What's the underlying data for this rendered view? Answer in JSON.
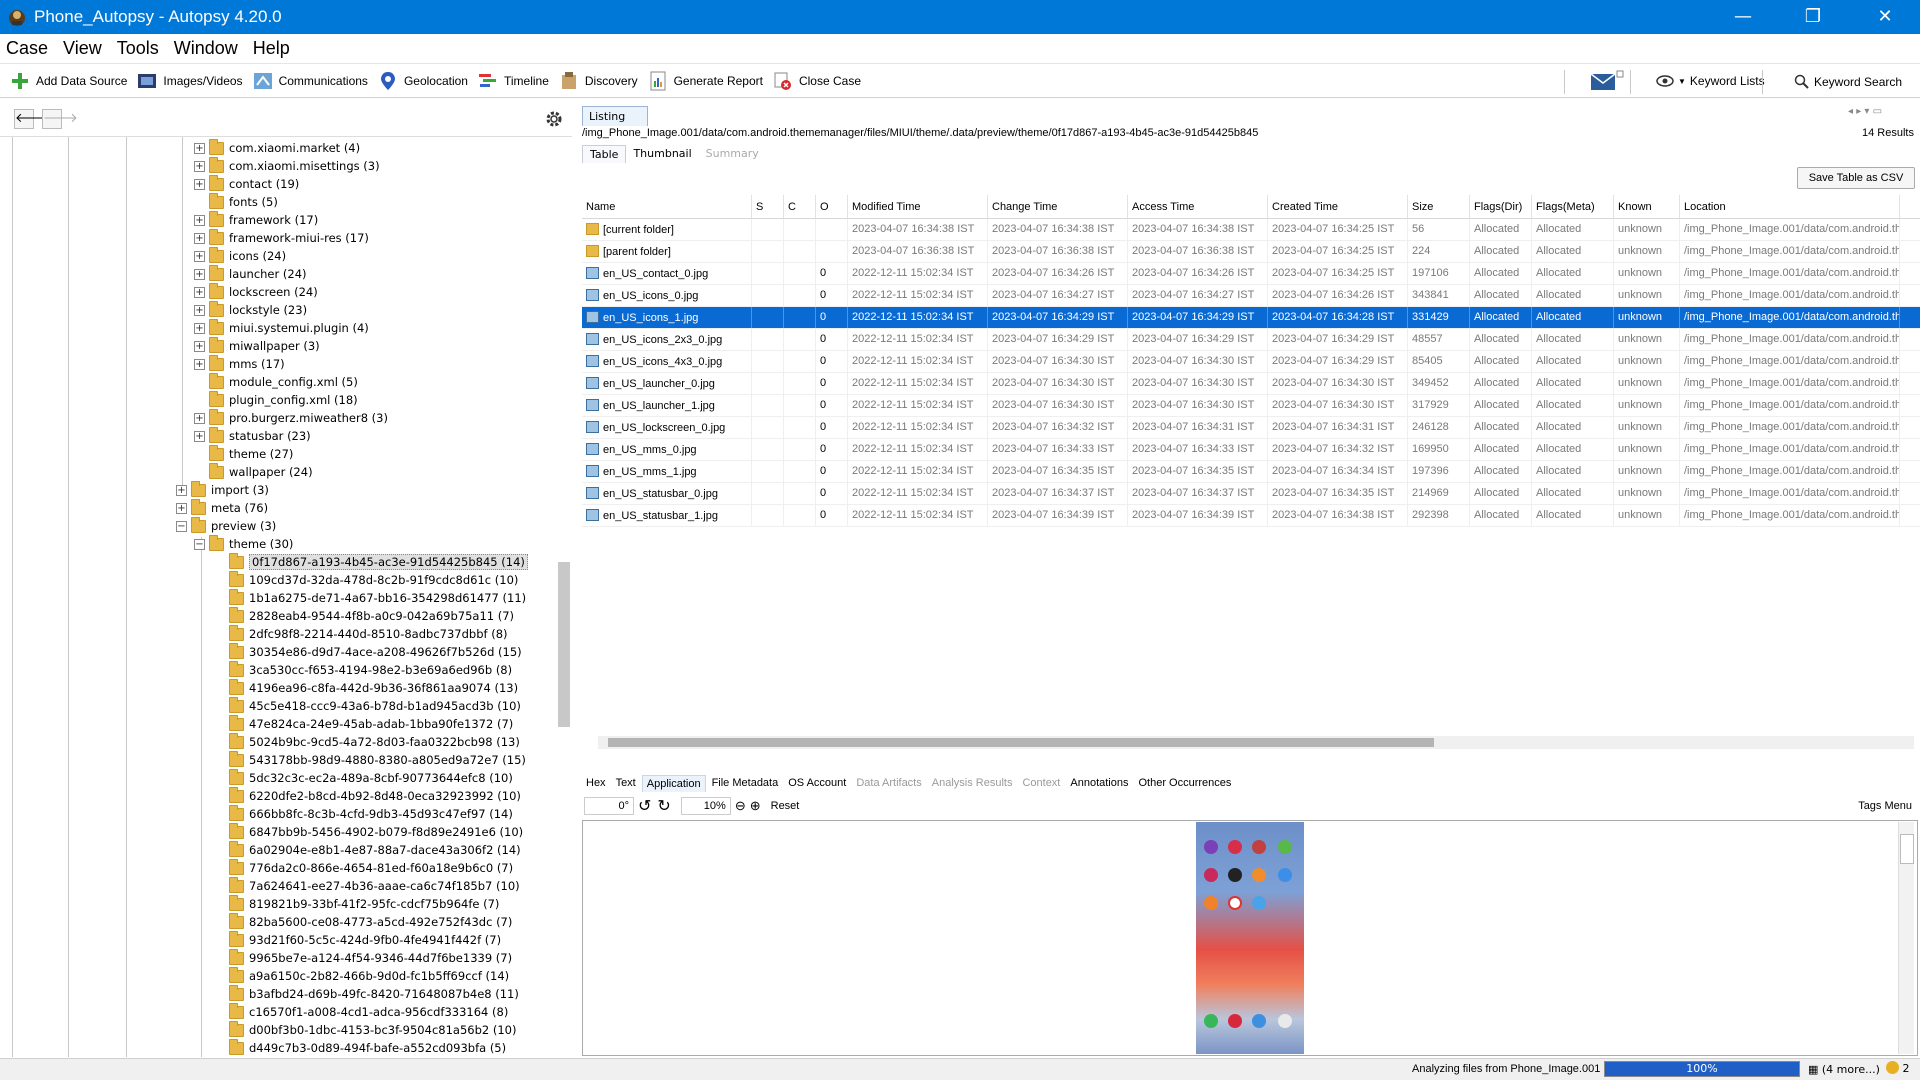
{
  "window": {
    "title": "Phone_Autopsy - Autopsy 4.20.0",
    "minimize": "—",
    "maximize": "❐",
    "close": "✕"
  },
  "menu": [
    "Case",
    "View",
    "Tools",
    "Window",
    "Help"
  ],
  "toolbar": {
    "add_data_source": "Add Data Source",
    "images_videos": "Images/Videos",
    "communications": "Communications",
    "geolocation": "Geolocation",
    "timeline": "Timeline",
    "discovery": "Discovery",
    "generate_report": "Generate Report",
    "close_case": "Close Case",
    "keyword_lists": "Keyword Lists",
    "keyword_search": "Keyword Search"
  },
  "tree": {
    "items": [
      {
        "label": "com.xiaomi.market (4)",
        "exp": true
      },
      {
        "label": "com.xiaomi.misettings (3)",
        "exp": true
      },
      {
        "label": "contact (19)",
        "exp": true
      },
      {
        "label": "fonts (5)",
        "exp": false
      },
      {
        "label": "framework (17)",
        "exp": true
      },
      {
        "label": "framework-miui-res (17)",
        "exp": true
      },
      {
        "label": "icons (24)",
        "exp": true
      },
      {
        "label": "launcher (24)",
        "exp": true
      },
      {
        "label": "lockscreen (24)",
        "exp": true
      },
      {
        "label": "lockstyle (23)",
        "exp": true
      },
      {
        "label": "miui.systemui.plugin (4)",
        "exp": true
      },
      {
        "label": "miwallpaper (3)",
        "exp": true
      },
      {
        "label": "mms (17)",
        "exp": true
      },
      {
        "label": "module_config.xml (5)",
        "exp": false
      },
      {
        "label": "plugin_config.xml (18)",
        "exp": false
      },
      {
        "label": "pro.burgerz.miweather8 (3)",
        "exp": true
      },
      {
        "label": "statusbar (23)",
        "exp": true
      },
      {
        "label": "theme (27)",
        "exp": false
      },
      {
        "label": "wallpaper (24)",
        "exp": false
      }
    ],
    "level1": [
      {
        "label": "import (3)",
        "sign": "+"
      },
      {
        "label": "meta (76)",
        "sign": "+"
      },
      {
        "label": "preview (3)",
        "sign": "−"
      }
    ],
    "theme_node": "theme (30)",
    "theme_children": [
      "0f17d867-a193-4b45-ac3e-91d54425b845 (14)",
      "109cd37d-32da-478d-8c2b-91f9cdc8d61c (10)",
      "1b1a6275-de71-4a67-bb16-354298d61477 (11)",
      "2828eab4-9544-4f8b-a0c9-042a69b75a11 (7)",
      "2dfc98f8-2214-440d-8510-8adbc737dbbf (8)",
      "30354e86-d9d7-4ace-a208-49626f7b526d (15)",
      "3ca530cc-f653-4194-98e2-b3e69a6ed96b (8)",
      "4196ea96-c8fa-442d-9b36-36f861aa9074 (13)",
      "45c5e418-ccc9-43a6-b78d-b1ad945acd3b (10)",
      "47e824ca-24e9-45ab-adab-1bba90fe1372 (7)",
      "5024b9bc-9cd5-4a72-8d03-faa0322bcb98 (13)",
      "543178bb-98d9-4880-8380-a805ed9a72e7 (15)",
      "5dc32c3c-ec2a-489a-8cbf-90773644efc8 (10)",
      "6220dfe2-b8cd-4b92-8d48-0eca32923992 (10)",
      "666bb8fc-8c3b-4cfd-9db3-45d93c47ef97 (14)",
      "6847bb9b-5456-4902-b079-f8d89e2491e6 (10)",
      "6a02904e-e8b1-4e87-88a7-dace43a306f2 (14)",
      "776da2c0-866e-4654-81ed-f60a18e9b6c0 (7)",
      "7a624641-ee27-4b36-aaae-ca6c74f185b7 (10)",
      "819821b9-33bf-41f2-95fc-cdcf75b964fe (7)",
      "82ba5600-ce08-4773-a5cd-492e752f43dc (7)",
      "93d21f60-5c5c-424d-9fb0-4fe4941f442f (7)",
      "9965be7e-a124-4f54-9346-44d7f6be1339 (7)",
      "a9a6150c-2b82-466b-9d0d-fc1b5ff69ccf (14)",
      "b3afbd24-d69b-49fc-8420-71648087b4e8 (11)",
      "c16570f1-a008-4cd1-adca-956cdf333164 (8)",
      "d00bf3b0-1dbc-4153-bc3f-9504c81a56b2 (10)",
      "d449c7b3-0d89-494f-bafe-a552cd093bfa (5)"
    ]
  },
  "listing": {
    "tab": "Listing",
    "path": "/img_Phone_Image.001/data/com.android.thememanager/files/MIUI/theme/.data/preview/theme/0f17d867-a193-4b45-ac3e-91d54425b845",
    "results": "14  Results",
    "subtabs": [
      "Table",
      "Thumbnail",
      "Summary"
    ],
    "save_csv": "Save Table as CSV",
    "columns": [
      "Name",
      "S",
      "C",
      "O",
      "Modified Time",
      "Change Time",
      "Access Time",
      "Created Time",
      "Size",
      "Flags(Dir)",
      "Flags(Meta)",
      "Known",
      "Location"
    ],
    "rows": [
      {
        "icon": "folder",
        "name": "[current folder]",
        "o": "",
        "mod": "2023-04-07 16:34:38 IST",
        "chg": "2023-04-07 16:34:38 IST",
        "acc": "2023-04-07 16:34:38 IST",
        "cre": "2023-04-07 16:34:25 IST",
        "size": "56",
        "fdir": "Allocated",
        "fmeta": "Allocated",
        "known": "unknown",
        "loc": "/img_Phone_Image.001/data/com.android.the"
      },
      {
        "icon": "folder",
        "name": "[parent folder]",
        "o": "",
        "mod": "2023-04-07 16:36:38 IST",
        "chg": "2023-04-07 16:36:38 IST",
        "acc": "2023-04-07 16:36:38 IST",
        "cre": "2023-04-07 16:34:25 IST",
        "size": "224",
        "fdir": "Allocated",
        "fmeta": "Allocated",
        "known": "unknown",
        "loc": "/img_Phone_Image.001/data/com.android.the"
      },
      {
        "icon": "image",
        "name": "en_US_contact_0.jpg",
        "o": "0",
        "mod": "2022-12-11 15:02:34 IST",
        "chg": "2023-04-07 16:34:26 IST",
        "acc": "2023-04-07 16:34:26 IST",
        "cre": "2023-04-07 16:34:25 IST",
        "size": "197106",
        "fdir": "Allocated",
        "fmeta": "Allocated",
        "known": "unknown",
        "loc": "/img_Phone_Image.001/data/com.android.the"
      },
      {
        "icon": "image",
        "name": "en_US_icons_0.jpg",
        "o": "0",
        "mod": "2022-12-11 15:02:34 IST",
        "chg": "2023-04-07 16:34:27 IST",
        "acc": "2023-04-07 16:34:27 IST",
        "cre": "2023-04-07 16:34:26 IST",
        "size": "343841",
        "fdir": "Allocated",
        "fmeta": "Allocated",
        "known": "unknown",
        "loc": "/img_Phone_Image.001/data/com.android.the"
      },
      {
        "icon": "image",
        "name": "en_US_icons_1.jpg",
        "o": "0",
        "mod": "2022-12-11 15:02:34 IST",
        "chg": "2023-04-07 16:34:29 IST",
        "acc": "2023-04-07 16:34:29 IST",
        "cre": "2023-04-07 16:34:28 IST",
        "size": "331429",
        "fdir": "Allocated",
        "fmeta": "Allocated",
        "known": "unknown",
        "loc": "/img_Phone_Image.001/data/com.android.the",
        "selected": true
      },
      {
        "icon": "image",
        "name": "en_US_icons_2x3_0.jpg",
        "o": "0",
        "mod": "2022-12-11 15:02:34 IST",
        "chg": "2023-04-07 16:34:29 IST",
        "acc": "2023-04-07 16:34:29 IST",
        "cre": "2023-04-07 16:34:29 IST",
        "size": "48557",
        "fdir": "Allocated",
        "fmeta": "Allocated",
        "known": "unknown",
        "loc": "/img_Phone_Image.001/data/com.android.the"
      },
      {
        "icon": "image",
        "name": "en_US_icons_4x3_0.jpg",
        "o": "0",
        "mod": "2022-12-11 15:02:34 IST",
        "chg": "2023-04-07 16:34:30 IST",
        "acc": "2023-04-07 16:34:30 IST",
        "cre": "2023-04-07 16:34:29 IST",
        "size": "85405",
        "fdir": "Allocated",
        "fmeta": "Allocated",
        "known": "unknown",
        "loc": "/img_Phone_Image.001/data/com.android.the"
      },
      {
        "icon": "image",
        "name": "en_US_launcher_0.jpg",
        "o": "0",
        "mod": "2022-12-11 15:02:34 IST",
        "chg": "2023-04-07 16:34:30 IST",
        "acc": "2023-04-07 16:34:30 IST",
        "cre": "2023-04-07 16:34:30 IST",
        "size": "349452",
        "fdir": "Allocated",
        "fmeta": "Allocated",
        "known": "unknown",
        "loc": "/img_Phone_Image.001/data/com.android.the"
      },
      {
        "icon": "image",
        "name": "en_US_launcher_1.jpg",
        "o": "0",
        "mod": "2022-12-11 15:02:34 IST",
        "chg": "2023-04-07 16:34:30 IST",
        "acc": "2023-04-07 16:34:30 IST",
        "cre": "2023-04-07 16:34:30 IST",
        "size": "317929",
        "fdir": "Allocated",
        "fmeta": "Allocated",
        "known": "unknown",
        "loc": "/img_Phone_Image.001/data/com.android.the"
      },
      {
        "icon": "image",
        "name": "en_US_lockscreen_0.jpg",
        "o": "0",
        "mod": "2022-12-11 15:02:34 IST",
        "chg": "2023-04-07 16:34:32 IST",
        "acc": "2023-04-07 16:34:31 IST",
        "cre": "2023-04-07 16:34:31 IST",
        "size": "246128",
        "fdir": "Allocated",
        "fmeta": "Allocated",
        "known": "unknown",
        "loc": "/img_Phone_Image.001/data/com.android.the"
      },
      {
        "icon": "image",
        "name": "en_US_mms_0.jpg",
        "o": "0",
        "mod": "2022-12-11 15:02:34 IST",
        "chg": "2023-04-07 16:34:33 IST",
        "acc": "2023-04-07 16:34:33 IST",
        "cre": "2023-04-07 16:34:32 IST",
        "size": "169950",
        "fdir": "Allocated",
        "fmeta": "Allocated",
        "known": "unknown",
        "loc": "/img_Phone_Image.001/data/com.android.the"
      },
      {
        "icon": "image",
        "name": "en_US_mms_1.jpg",
        "o": "0",
        "mod": "2022-12-11 15:02:34 IST",
        "chg": "2023-04-07 16:34:35 IST",
        "acc": "2023-04-07 16:34:35 IST",
        "cre": "2023-04-07 16:34:34 IST",
        "size": "197396",
        "fdir": "Allocated",
        "fmeta": "Allocated",
        "known": "unknown",
        "loc": "/img_Phone_Image.001/data/com.android.the"
      },
      {
        "icon": "image",
        "name": "en_US_statusbar_0.jpg",
        "o": "0",
        "mod": "2022-12-11 15:02:34 IST",
        "chg": "2023-04-07 16:34:37 IST",
        "acc": "2023-04-07 16:34:37 IST",
        "cre": "2023-04-07 16:34:35 IST",
        "size": "214969",
        "fdir": "Allocated",
        "fmeta": "Allocated",
        "known": "unknown",
        "loc": "/img_Phone_Image.001/data/com.android.the"
      },
      {
        "icon": "image",
        "name": "en_US_statusbar_1.jpg",
        "o": "0",
        "mod": "2022-12-11 15:02:34 IST",
        "chg": "2023-04-07 16:34:39 IST",
        "acc": "2023-04-07 16:34:39 IST",
        "cre": "2023-04-07 16:34:38 IST",
        "size": "292398",
        "fdir": "Allocated",
        "fmeta": "Allocated",
        "known": "unknown",
        "loc": "/img_Phone_Image.001/data/com.android.the"
      }
    ]
  },
  "content_tabs": [
    {
      "label": "Hex",
      "state": "normal"
    },
    {
      "label": "Text",
      "state": "normal"
    },
    {
      "label": "Application",
      "state": "active"
    },
    {
      "label": "File Metadata",
      "state": "normal"
    },
    {
      "label": "OS Account",
      "state": "normal"
    },
    {
      "label": "Data Artifacts",
      "state": "disabled"
    },
    {
      "label": "Analysis Results",
      "state": "disabled"
    },
    {
      "label": "Context",
      "state": "disabled"
    },
    {
      "label": "Annotations",
      "state": "normal"
    },
    {
      "label": "Other Occurrences",
      "state": "normal"
    }
  ],
  "viewer": {
    "rotation": "0°",
    "zoom": "10%",
    "reset": "Reset",
    "tags_menu": "Tags Menu"
  },
  "status": {
    "text": "Analyzing files from Phone_Image.001",
    "progress": "100%",
    "more": "(4 more...)",
    "count": "2"
  },
  "colors": {
    "accent": "#0078d7",
    "selection": "#0a6ad4",
    "folder": "#e8b946"
  }
}
